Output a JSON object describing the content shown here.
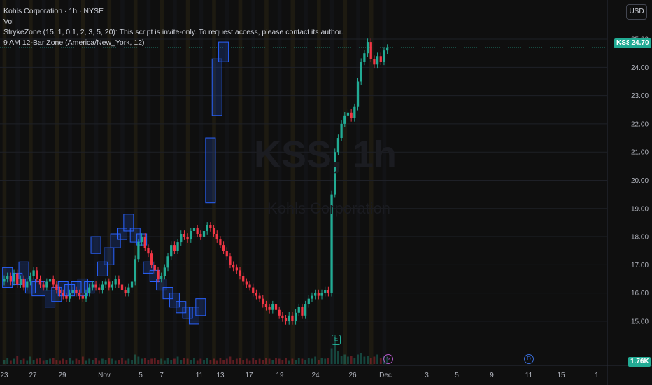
{
  "legend": {
    "title": "Kohls Corporation · 1h · NYSE",
    "vol": "Vol",
    "indicator1": "StrykeZone (15, 1, 0.1, 2, 3, 5, 20): This script is invite-only. To request access, please contact its author.",
    "indicator2": "9 AM 12-Bar Zone (America/New_York, 12)"
  },
  "toolbar": {
    "currency": "USD"
  },
  "watermark": {
    "symbol": "KSS, 1h",
    "name": "Kohls Corporation"
  },
  "price_tags": {
    "symbol": "KSS",
    "last_price": "24.70",
    "volume": "1.76K"
  },
  "events": {
    "earnings": "E",
    "split": "ϟ",
    "dividend": "D"
  },
  "colors": {
    "up": "#22ab94",
    "down": "#f23645",
    "zone": "#2962ff",
    "background": "#0f0f0f"
  },
  "chart_data": {
    "type": "candlestick",
    "title": "Kohls Corporation · 1h · NYSE",
    "y_ticks": [
      "25.00",
      "24.00",
      "23.00",
      "22.00",
      "21.00",
      "20.00",
      "19.00",
      "18.00",
      "17.00",
      "16.00",
      "15.00"
    ],
    "x_ticks": [
      "23",
      "27",
      "29",
      "Nov",
      "5",
      "7",
      "11",
      "13",
      "17",
      "19",
      "24",
      "26",
      "Dec",
      "3",
      "5",
      "9",
      "11",
      "15",
      "1"
    ],
    "last_price": 24.7,
    "series": [
      {
        "name": "KSS",
        "values": [
          16.5,
          16.6,
          16.4,
          16.7,
          16.3,
          16.5,
          16.2,
          16.4,
          16.6,
          16.8,
          16.5,
          16.3,
          16.2,
          16.4,
          16.5,
          16.3,
          16.1,
          16.0,
          15.9,
          15.8,
          16.0,
          16.1,
          16.0,
          15.9,
          15.8,
          16.0,
          16.2,
          16.3,
          16.2,
          16.1,
          16.3,
          16.4,
          16.2,
          16.3,
          16.5,
          16.3,
          16.1,
          16.0,
          16.2,
          16.4,
          17.2,
          17.8,
          18.0,
          17.6,
          17.4,
          17.0,
          16.8,
          16.5,
          16.6,
          16.9,
          17.3,
          17.7,
          17.5,
          17.8,
          18.1,
          18.0,
          17.9,
          18.2,
          18.3,
          18.1,
          18.0,
          18.2,
          18.4,
          18.3,
          18.1,
          17.9,
          17.7,
          17.5,
          17.3,
          17.0,
          16.9,
          16.8,
          16.6,
          16.4,
          16.3,
          16.2,
          16.0,
          15.9,
          15.8,
          15.6,
          15.5,
          15.4,
          15.6,
          15.4,
          15.2,
          15.1,
          15.0,
          15.2,
          15.0,
          15.3,
          15.5,
          15.2,
          15.6,
          15.8,
          15.9,
          16.0,
          15.9,
          16.0,
          16.1,
          16.0,
          19.5,
          21.0,
          21.5,
          22.0,
          22.3,
          22.4,
          22.2,
          22.6,
          23.5,
          24.2,
          24.5,
          24.9,
          24.3,
          24.1,
          24.4,
          24.2,
          24.6,
          24.7
        ]
      },
      {
        "name": "Vol",
        "values": [
          0.4,
          0.6,
          0.3,
          0.5,
          0.8,
          0.4,
          0.5,
          0.3,
          0.7,
          0.4,
          0.5,
          0.6,
          0.3,
          0.4,
          0.5,
          0.6,
          0.4,
          0.3,
          0.5,
          0.4,
          0.6,
          0.3,
          0.5,
          0.4,
          0.7,
          0.3,
          0.5,
          0.4,
          0.6,
          0.3,
          0.5,
          0.4,
          0.6,
          0.5,
          0.3,
          0.4,
          0.6,
          0.3,
          0.5,
          0.4,
          0.9,
          0.7,
          0.5,
          0.6,
          0.4,
          0.5,
          0.6,
          0.4,
          0.5,
          0.3,
          0.6,
          0.4,
          0.5,
          0.7,
          0.4,
          0.6,
          0.5,
          0.4,
          0.6,
          0.3,
          0.5,
          0.4,
          0.6,
          0.4,
          0.5,
          0.3,
          0.6,
          0.4,
          0.5,
          0.7,
          0.4,
          0.5,
          0.6,
          0.4,
          0.5,
          0.3,
          0.6,
          0.4,
          0.5,
          0.4,
          0.6,
          0.5,
          0.4,
          0.6,
          0.5,
          0.4,
          0.6,
          0.3,
          0.5,
          0.4,
          0.6,
          0.5,
          0.4,
          0.6,
          0.5,
          0.7,
          0.4,
          0.6,
          0.5,
          0.6,
          1.5,
          2.8,
          1.2,
          0.8,
          0.9,
          0.7,
          0.8,
          0.6,
          0.9,
          1.0,
          0.7,
          0.8,
          0.6,
          0.7,
          0.9,
          0.6,
          0.8,
          0.7
        ]
      }
    ],
    "zones": [
      {
        "x0": 0,
        "x1": 2,
        "y0": 16.9,
        "y1": 16.2
      },
      {
        "x0": 3,
        "x1": 5,
        "y0": 16.7,
        "y1": 16.3
      },
      {
        "x0": 5,
        "x1": 7,
        "y0": 17.1,
        "y1": 16.5
      },
      {
        "x0": 7,
        "x1": 9,
        "y0": 16.5,
        "y1": 16.0
      },
      {
        "x0": 9,
        "x1": 12,
        "y0": 16.4,
        "y1": 15.9
      },
      {
        "x0": 13,
        "x1": 15,
        "y0": 16.1,
        "y1": 15.5
      },
      {
        "x0": 15,
        "x1": 17,
        "y0": 16.2,
        "y1": 15.7
      },
      {
        "x0": 17,
        "x1": 19,
        "y0": 16.4,
        "y1": 15.9
      },
      {
        "x0": 19,
        "x1": 21,
        "y0": 16.3,
        "y1": 15.9
      },
      {
        "x0": 21,
        "x1": 23,
        "y0": 16.4,
        "y1": 16.0
      },
      {
        "x0": 23,
        "x1": 25,
        "y0": 16.5,
        "y1": 15.9
      },
      {
        "x0": 25,
        "x1": 27,
        "y0": 16.4,
        "y1": 16.0
      },
      {
        "x0": 27,
        "x1": 29,
        "y0": 18.0,
        "y1": 17.4
      },
      {
        "x0": 29,
        "x1": 31,
        "y0": 17.1,
        "y1": 16.6
      },
      {
        "x0": 31,
        "x1": 33,
        "y0": 17.6,
        "y1": 17.0
      },
      {
        "x0": 33,
        "x1": 35,
        "y0": 18.1,
        "y1": 17.6
      },
      {
        "x0": 35,
        "x1": 37,
        "y0": 18.3,
        "y1": 17.9
      },
      {
        "x0": 37,
        "x1": 39,
        "y0": 18.8,
        "y1": 18.2
      },
      {
        "x0": 39,
        "x1": 41,
        "y0": 18.3,
        "y1": 17.8
      },
      {
        "x0": 41,
        "x1": 43,
        "y0": 18.1,
        "y1": 17.7
      },
      {
        "x0": 43,
        "x1": 45,
        "y0": 17.1,
        "y1": 16.7
      },
      {
        "x0": 45,
        "x1": 47,
        "y0": 16.8,
        "y1": 16.4
      },
      {
        "x0": 47,
        "x1": 49,
        "y0": 16.5,
        "y1": 16.1
      },
      {
        "x0": 49,
        "x1": 51,
        "y0": 16.2,
        "y1": 15.8
      },
      {
        "x0": 51,
        "x1": 53,
        "y0": 16.0,
        "y1": 15.5
      },
      {
        "x0": 53,
        "x1": 55,
        "y0": 15.7,
        "y1": 15.3
      },
      {
        "x0": 55,
        "x1": 57,
        "y0": 15.5,
        "y1": 15.1
      },
      {
        "x0": 57,
        "x1": 59,
        "y0": 15.5,
        "y1": 14.9
      },
      {
        "x0": 59,
        "x1": 61,
        "y0": 15.8,
        "y1": 15.2
      },
      {
        "x0": 62,
        "x1": 64,
        "y0": 21.5,
        "y1": 19.2
      },
      {
        "x0": 64,
        "x1": 66,
        "y0": 24.3,
        "y1": 22.3
      },
      {
        "x0": 66,
        "x1": 68,
        "y0": 24.9,
        "y1": 24.2
      }
    ]
  }
}
